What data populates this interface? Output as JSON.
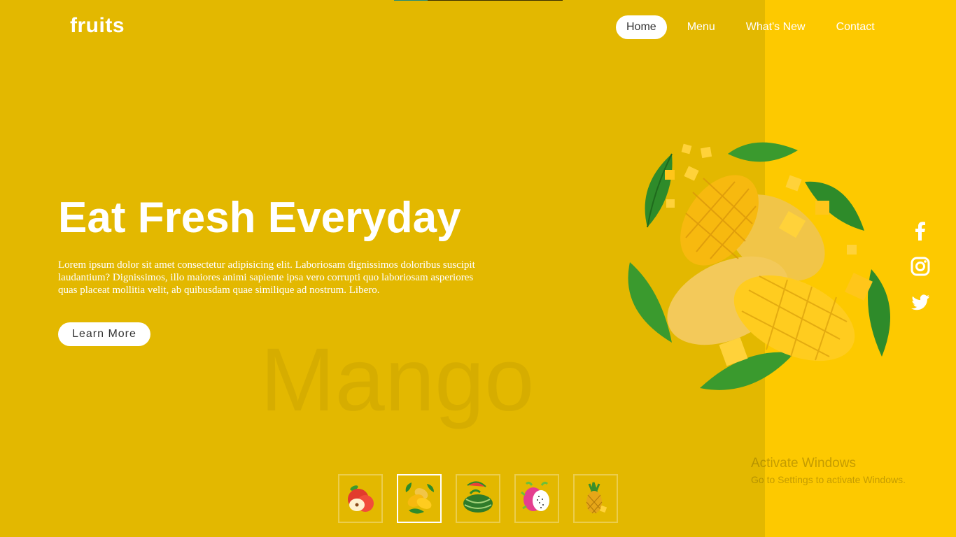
{
  "brand": {
    "logo": "fruits"
  },
  "nav": {
    "items": [
      "Home",
      "Menu",
      "What's New",
      "Contact"
    ],
    "active": "Home"
  },
  "hero": {
    "title": "Eat Fresh Everyday",
    "text": "Lorem ipsum dolor sit amet consectetur adipisicing elit. Laboriosam dignissimos doloribus suscipit laudantium? Dignissimos, illo maiores animi sapiente ipsa vero corrupti quo laboriosam asperiores quas placeat mollitia velit, ab quibusdam quae similique ad nostrum. Libero.",
    "button": "Learn More",
    "background_word": "Mango"
  },
  "social": {
    "icons": [
      "facebook-icon",
      "instagram-icon",
      "twitter-icon"
    ]
  },
  "thumbnails": {
    "items": [
      "apple",
      "mango",
      "watermelon",
      "dragon fruit",
      "pineapple"
    ],
    "active": "mango"
  },
  "overlay": {
    "activate_title": "Activate Windows",
    "activate_sub": "Go to Settings to activate Windows."
  },
  "colors": {
    "background": "#e3b800",
    "right_panel": "#fdc900",
    "accent_white": "#ffffff"
  }
}
